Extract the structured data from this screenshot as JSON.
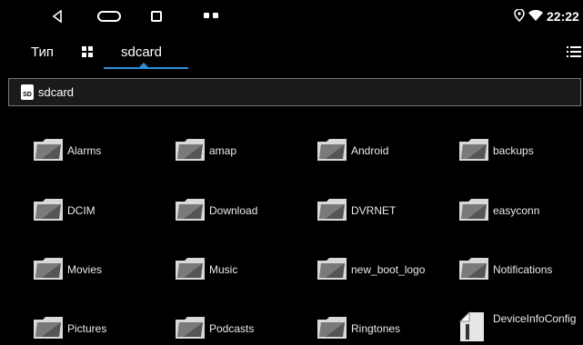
{
  "status": {
    "time": "22:22"
  },
  "tabs": {
    "type_label": "Тип",
    "location_label": "sdcard"
  },
  "path": {
    "text": "sdcard",
    "sd_icon_text": "SD"
  },
  "items": [
    {
      "label": "Alarms"
    },
    {
      "label": "amap"
    },
    {
      "label": "Android"
    },
    {
      "label": "backups"
    },
    {
      "label": "DCIM"
    },
    {
      "label": "Download"
    },
    {
      "label": "DVRNET"
    },
    {
      "label": "easyconn"
    },
    {
      "label": "Movies"
    },
    {
      "label": "Music"
    },
    {
      "label": "new_boot_logo"
    },
    {
      "label": "Notifications"
    },
    {
      "label": "Pictures"
    },
    {
      "label": "Podcasts"
    },
    {
      "label": "Ringtones"
    },
    {
      "label": "DeviceInfoConfig"
    }
  ],
  "colors": {
    "accent": "#2b8fd8",
    "background": "#000000"
  }
}
